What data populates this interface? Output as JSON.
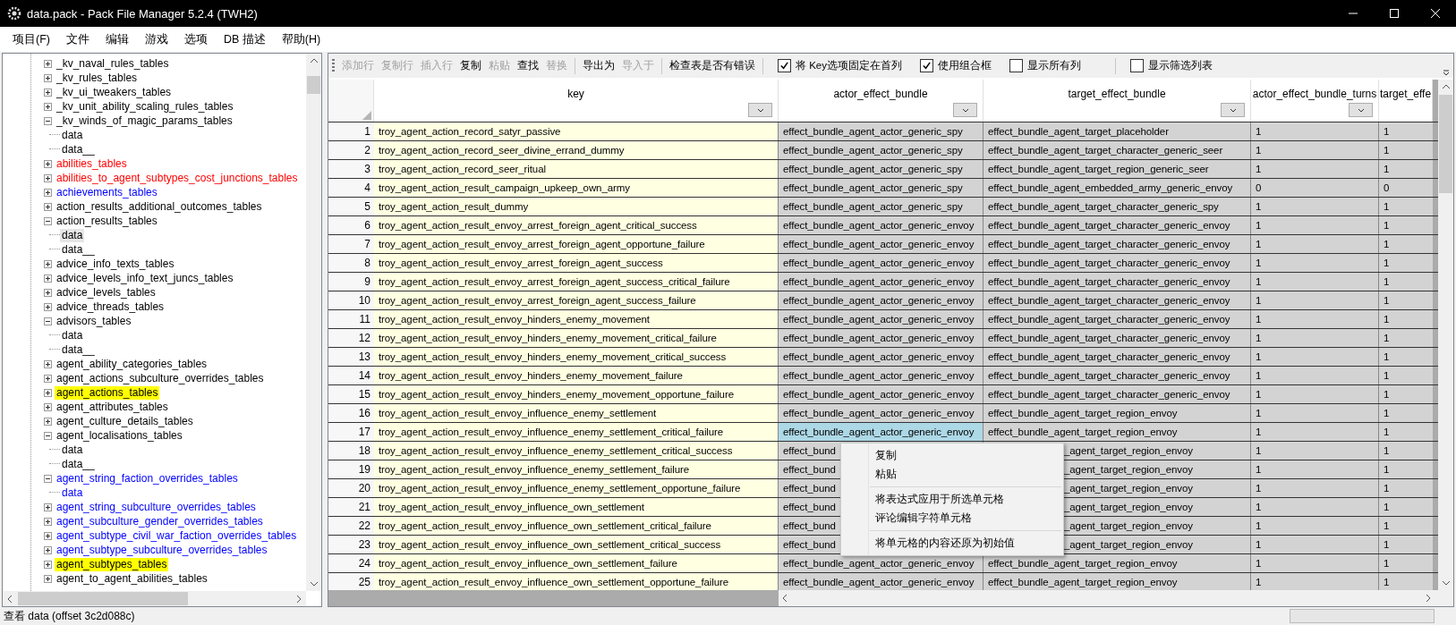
{
  "window": {
    "title": "data.pack - Pack File Manager 5.2.4 (TWH2)"
  },
  "menu": [
    "项目(F)",
    "文件",
    "编辑",
    "游戏",
    "选项",
    "DB 描述",
    "帮助(H)"
  ],
  "tree": [
    {
      "label": "_kv_naval_rules_tables",
      "color": "#000000",
      "expanded": false,
      "highlighted": false
    },
    {
      "label": "_kv_rules_tables",
      "color": "#000000",
      "expanded": false,
      "highlighted": false
    },
    {
      "label": "_kv_ui_tweakers_tables",
      "color": "#000000",
      "expanded": false,
      "highlighted": false
    },
    {
      "label": "_kv_unit_ability_scaling_rules_tables",
      "color": "#000000",
      "expanded": false,
      "highlighted": false
    },
    {
      "label": "_kv_winds_of_magic_params_tables",
      "color": "#000000",
      "expanded": true,
      "highlighted": false,
      "children": [
        {
          "label": "data",
          "color": "#000000",
          "selected": false
        },
        {
          "label": "data__",
          "color": "#000000",
          "selected": false
        }
      ]
    },
    {
      "label": "abilities_tables",
      "color": "#ff0000",
      "expanded": false,
      "highlighted": false
    },
    {
      "label": "abilities_to_agent_subtypes_cost_junctions_tables",
      "color": "#ff0000",
      "expanded": false,
      "highlighted": false
    },
    {
      "label": "achievements_tables",
      "color": "#0000ff",
      "expanded": false,
      "highlighted": false
    },
    {
      "label": "action_results_additional_outcomes_tables",
      "color": "#000000",
      "expanded": false,
      "highlighted": false
    },
    {
      "label": "action_results_tables",
      "color": "#000000",
      "expanded": true,
      "highlighted": false,
      "children": [
        {
          "label": "data",
          "color": "#000000",
          "selected": true
        },
        {
          "label": "data__",
          "color": "#000000",
          "selected": false
        }
      ]
    },
    {
      "label": "advice_info_texts_tables",
      "color": "#000000",
      "expanded": false,
      "highlighted": false
    },
    {
      "label": "advice_levels_info_text_juncs_tables",
      "color": "#000000",
      "expanded": false,
      "highlighted": false
    },
    {
      "label": "advice_levels_tables",
      "color": "#000000",
      "expanded": false,
      "highlighted": false
    },
    {
      "label": "advice_threads_tables",
      "color": "#000000",
      "expanded": false,
      "highlighted": false
    },
    {
      "label": "advisors_tables",
      "color": "#000000",
      "expanded": true,
      "highlighted": false,
      "children": [
        {
          "label": "data",
          "color": "#000000",
          "selected": false
        },
        {
          "label": "data__",
          "color": "#000000",
          "selected": false
        }
      ]
    },
    {
      "label": "agent_ability_categories_tables",
      "color": "#000000",
      "expanded": false,
      "highlighted": false
    },
    {
      "label": "agent_actions_subculture_overrides_tables",
      "color": "#000000",
      "expanded": false,
      "highlighted": false
    },
    {
      "label": "agent_actions_tables",
      "expanded": false,
      "highlighted": true
    },
    {
      "label": "agent_attributes_tables",
      "color": "#000000",
      "expanded": false,
      "highlighted": false
    },
    {
      "label": "agent_culture_details_tables",
      "color": "#000000",
      "expanded": false,
      "highlighted": false
    },
    {
      "label": "agent_localisations_tables",
      "color": "#000000",
      "expanded": true,
      "highlighted": false,
      "children": [
        {
          "label": "data",
          "color": "#000000",
          "selected": false
        },
        {
          "label": "data__",
          "color": "#000000",
          "selected": false
        }
      ]
    },
    {
      "label": "agent_string_faction_overrides_tables",
      "color": "#0000ff",
      "expanded": true,
      "highlighted": false,
      "children": [
        {
          "label": "data",
          "color": "#0000ff",
          "selected": false
        }
      ]
    },
    {
      "label": "agent_string_subculture_overrides_tables",
      "color": "#0000ff",
      "expanded": false,
      "highlighted": false
    },
    {
      "label": "agent_subculture_gender_overrides_tables",
      "color": "#0000ff",
      "expanded": false,
      "highlighted": false
    },
    {
      "label": "agent_subtype_civil_war_faction_overrides_tables",
      "color": "#0000ff",
      "expanded": false,
      "highlighted": false
    },
    {
      "label": "agent_subtype_subculture_overrides_tables",
      "color": "#0000ff",
      "expanded": false,
      "highlighted": false
    },
    {
      "label": "agent_subtypes_tables",
      "expanded": false,
      "highlighted": true
    },
    {
      "label": "agent_to_agent_abilities_tables",
      "color": "#000000",
      "expanded": false,
      "highlighted": false
    }
  ],
  "toolbar": {
    "buttons": [
      {
        "label": "添加行",
        "disabled": true,
        "separator_before": false
      },
      {
        "label": "复制行",
        "disabled": true,
        "separator_before": false
      },
      {
        "label": "插入行",
        "disabled": true,
        "separator_before": false
      },
      {
        "label": "复制",
        "disabled": false,
        "separator_before": false
      },
      {
        "label": "粘贴",
        "disabled": true,
        "separator_before": false
      },
      {
        "label": "查找",
        "disabled": false,
        "separator_before": false
      },
      {
        "label": "替换",
        "disabled": true,
        "separator_before": false
      },
      {
        "label": "导出为",
        "disabled": false,
        "separator_before": true
      },
      {
        "label": "导入于",
        "disabled": true,
        "separator_before": false
      },
      {
        "label": "检查表是否有错误",
        "disabled": false,
        "separator_before": true
      }
    ],
    "checkboxes": [
      {
        "label": "将 Key选项固定在首列",
        "checked": true
      },
      {
        "label": "使用组合框",
        "checked": true
      },
      {
        "label": "显示所有列",
        "checked": false
      },
      {
        "label": "显示筛选列表",
        "checked": false
      }
    ]
  },
  "table": {
    "columns": [
      {
        "label": "key",
        "filter": true
      },
      {
        "label": "actor_effect_bundle",
        "filter": true
      },
      {
        "label": "target_effect_bundle",
        "filter": true
      },
      {
        "label": "actor_effect_bundle_turns",
        "filter": true
      },
      {
        "label": "target_effe",
        "filter": false
      }
    ],
    "rows": [
      {
        "n": "1",
        "cells": [
          "troy_agent_action_record_satyr_passive",
          "effect_bundle_agent_actor_generic_spy",
          "effect_bundle_agent_target_placeholder",
          "1",
          "1"
        ],
        "selected": false,
        "under_menu": false
      },
      {
        "n": "2",
        "cells": [
          "troy_agent_action_record_seer_divine_errand_dummy",
          "effect_bundle_agent_actor_generic_spy",
          "effect_bundle_agent_target_character_generic_seer",
          "1",
          "1"
        ],
        "selected": false,
        "under_menu": false
      },
      {
        "n": "3",
        "cells": [
          "troy_agent_action_record_seer_ritual",
          "effect_bundle_agent_actor_generic_spy",
          "effect_bundle_agent_target_region_generic_seer",
          "1",
          "1"
        ],
        "selected": false,
        "under_menu": false
      },
      {
        "n": "4",
        "cells": [
          "troy_agent_action_result_campaign_upkeep_own_army",
          "effect_bundle_agent_actor_generic_spy",
          "effect_bundle_agent_embedded_army_generic_envoy",
          "0",
          "0"
        ],
        "selected": false,
        "under_menu": false
      },
      {
        "n": "5",
        "cells": [
          "troy_agent_action_result_dummy",
          "effect_bundle_agent_actor_generic_spy",
          "effect_bundle_agent_target_character_generic_spy",
          "1",
          "1"
        ],
        "selected": false,
        "under_menu": false
      },
      {
        "n": "6",
        "cells": [
          "troy_agent_action_result_envoy_arrest_foreign_agent_critical_success",
          "effect_bundle_agent_actor_generic_envoy",
          "effect_bundle_agent_target_character_generic_envoy",
          "1",
          "1"
        ],
        "selected": false,
        "under_menu": false
      },
      {
        "n": "7",
        "cells": [
          "troy_agent_action_result_envoy_arrest_foreign_agent_opportune_failure",
          "effect_bundle_agent_actor_generic_envoy",
          "effect_bundle_agent_target_character_generic_envoy",
          "1",
          "1"
        ],
        "selected": false,
        "under_menu": false
      },
      {
        "n": "8",
        "cells": [
          "troy_agent_action_result_envoy_arrest_foreign_agent_success",
          "effect_bundle_agent_actor_generic_envoy",
          "effect_bundle_agent_target_character_generic_envoy",
          "1",
          "1"
        ],
        "selected": false,
        "under_menu": false
      },
      {
        "n": "9",
        "cells": [
          "troy_agent_action_result_envoy_arrest_foreign_agent_success_critical_failure",
          "effect_bundle_agent_actor_generic_envoy",
          "effect_bundle_agent_target_character_generic_envoy",
          "1",
          "1"
        ],
        "selected": false,
        "under_menu": false
      },
      {
        "n": "10",
        "cells": [
          "troy_agent_action_result_envoy_arrest_foreign_agent_success_failure",
          "effect_bundle_agent_actor_generic_envoy",
          "effect_bundle_agent_target_character_generic_envoy",
          "1",
          "1"
        ],
        "selected": false,
        "under_menu": false
      },
      {
        "n": "11",
        "cells": [
          "troy_agent_action_result_envoy_hinders_enemy_movement",
          "effect_bundle_agent_actor_generic_envoy",
          "effect_bundle_agent_target_character_generic_envoy",
          "1",
          "1"
        ],
        "selected": false,
        "under_menu": false
      },
      {
        "n": "12",
        "cells": [
          "troy_agent_action_result_envoy_hinders_enemy_movement_critical_failure",
          "effect_bundle_agent_actor_generic_envoy",
          "effect_bundle_agent_target_character_generic_envoy",
          "1",
          "1"
        ],
        "selected": false,
        "under_menu": false
      },
      {
        "n": "13",
        "cells": [
          "troy_agent_action_result_envoy_hinders_enemy_movement_critical_success",
          "effect_bundle_agent_actor_generic_envoy",
          "effect_bundle_agent_target_character_generic_envoy",
          "1",
          "1"
        ],
        "selected": false,
        "under_menu": false
      },
      {
        "n": "14",
        "cells": [
          "troy_agent_action_result_envoy_hinders_enemy_movement_failure",
          "effect_bundle_agent_actor_generic_envoy",
          "effect_bundle_agent_target_character_generic_envoy",
          "1",
          "1"
        ],
        "selected": false,
        "under_menu": false
      },
      {
        "n": "15",
        "cells": [
          "troy_agent_action_result_envoy_hinders_enemy_movement_opportune_failure",
          "effect_bundle_agent_actor_generic_envoy",
          "effect_bundle_agent_target_character_generic_envoy",
          "1",
          "1"
        ],
        "selected": false,
        "under_menu": false
      },
      {
        "n": "16",
        "cells": [
          "troy_agent_action_result_envoy_influence_enemy_settlement",
          "effect_bundle_agent_actor_generic_envoy",
          "effect_bundle_agent_target_region_envoy",
          "1",
          "1"
        ],
        "selected": false,
        "under_menu": false
      },
      {
        "n": "17",
        "cells": [
          "troy_agent_action_result_envoy_influence_enemy_settlement_critical_failure",
          "effect_bundle_agent_actor_generic_envoy",
          "effect_bundle_agent_target_region_envoy",
          "1",
          "1"
        ],
        "selected": true,
        "under_menu": false
      },
      {
        "n": "18",
        "cells": [
          "troy_agent_action_result_envoy_influence_enemy_settlement_critical_success",
          "effect_bund",
          "_agent_target_region_envoy",
          "1",
          "1"
        ],
        "selected": false,
        "under_menu": true
      },
      {
        "n": "19",
        "cells": [
          "troy_agent_action_result_envoy_influence_enemy_settlement_failure",
          "effect_bund",
          "_agent_target_region_envoy",
          "1",
          "1"
        ],
        "selected": false,
        "under_menu": true
      },
      {
        "n": "20",
        "cells": [
          "troy_agent_action_result_envoy_influence_enemy_settlement_opportune_failure",
          "effect_bund",
          "_agent_target_region_envoy",
          "1",
          "1"
        ],
        "selected": false,
        "under_menu": true
      },
      {
        "n": "21",
        "cells": [
          "troy_agent_action_result_envoy_influence_own_settlement",
          "effect_bund",
          "_agent_target_region_envoy",
          "1",
          "1"
        ],
        "selected": false,
        "under_menu": true
      },
      {
        "n": "22",
        "cells": [
          "troy_agent_action_result_envoy_influence_own_settlement_critical_failure",
          "effect_bund",
          "_agent_target_region_envoy",
          "1",
          "1"
        ],
        "selected": false,
        "under_menu": true
      },
      {
        "n": "23",
        "cells": [
          "troy_agent_action_result_envoy_influence_own_settlement_critical_success",
          "effect_bund",
          "_agent_target_region_envoy",
          "1",
          "1"
        ],
        "selected": false,
        "under_menu": true
      },
      {
        "n": "24",
        "cells": [
          "troy_agent_action_result_envoy_influence_own_settlement_failure",
          "effect_bundle_agent_actor_generic_envoy",
          "effect_bundle_agent_target_region_envoy",
          "1",
          "1"
        ],
        "selected": false,
        "under_menu": false
      },
      {
        "n": "25",
        "cells": [
          "troy_agent_action_result_envoy_influence_own_settlement_opportune_failure",
          "effect_bundle_agent_actor_generic_envoy",
          "effect_bundle_agent_target_region_envoy",
          "1",
          "1"
        ],
        "selected": false,
        "under_menu": false
      }
    ]
  },
  "context_menu": [
    {
      "kind": "item",
      "label": "复制"
    },
    {
      "kind": "item",
      "label": "粘贴"
    },
    {
      "kind": "separator"
    },
    {
      "kind": "item",
      "label": "将表达式应用于所选单元格"
    },
    {
      "kind": "item",
      "label": "评论编辑字符单元格"
    },
    {
      "kind": "separator"
    },
    {
      "kind": "item",
      "label": "将单元格的内容还原为初始值"
    }
  ],
  "status_bar": {
    "text": "查看 data (offset 3c2d088c)"
  }
}
